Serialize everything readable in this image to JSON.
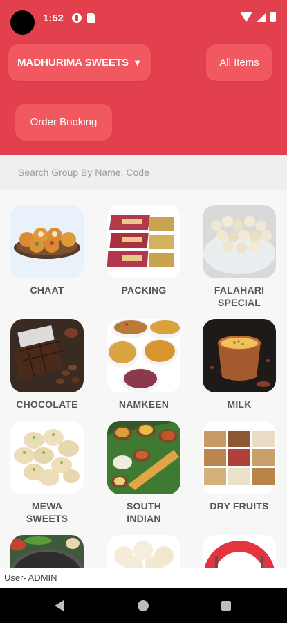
{
  "status_bar": {
    "time": "1:52"
  },
  "header": {
    "shop_name": "MADHURIMA SWEETS",
    "shop_caret": "▼",
    "all_items_label": "All Items",
    "order_booking_label": "Order Booking",
    "background_color": "#e2404c",
    "button_color": "#f25860"
  },
  "search": {
    "placeholder": "Search Group By Name, Code",
    "value": ""
  },
  "categories": [
    {
      "label": "CHAAT",
      "icon": "chaat-image"
    },
    {
      "label": "PACKING",
      "icon": "packing-image"
    },
    {
      "label": "FALAHARI\nSPECIAL",
      "icon": "falahari-special-image"
    },
    {
      "label": "CHOCOLATE",
      "icon": "chocolate-image"
    },
    {
      "label": "NAMKEEN",
      "icon": "namkeen-image"
    },
    {
      "label": "MILK",
      "icon": "milk-image"
    },
    {
      "label": "MEWA\nSWEETS",
      "icon": "mewa-sweets-image"
    },
    {
      "label": "SOUTH\nINDIAN",
      "icon": "south-indian-image"
    },
    {
      "label": "DRY FRUITS",
      "icon": "dry-fruits-image"
    },
    {
      "label": "",
      "icon": "thali-image"
    },
    {
      "label": "",
      "icon": "rasgulla-image"
    },
    {
      "label": "",
      "icon": "plate-image"
    }
  ],
  "footer": {
    "user_text": "User-  ADMIN"
  }
}
